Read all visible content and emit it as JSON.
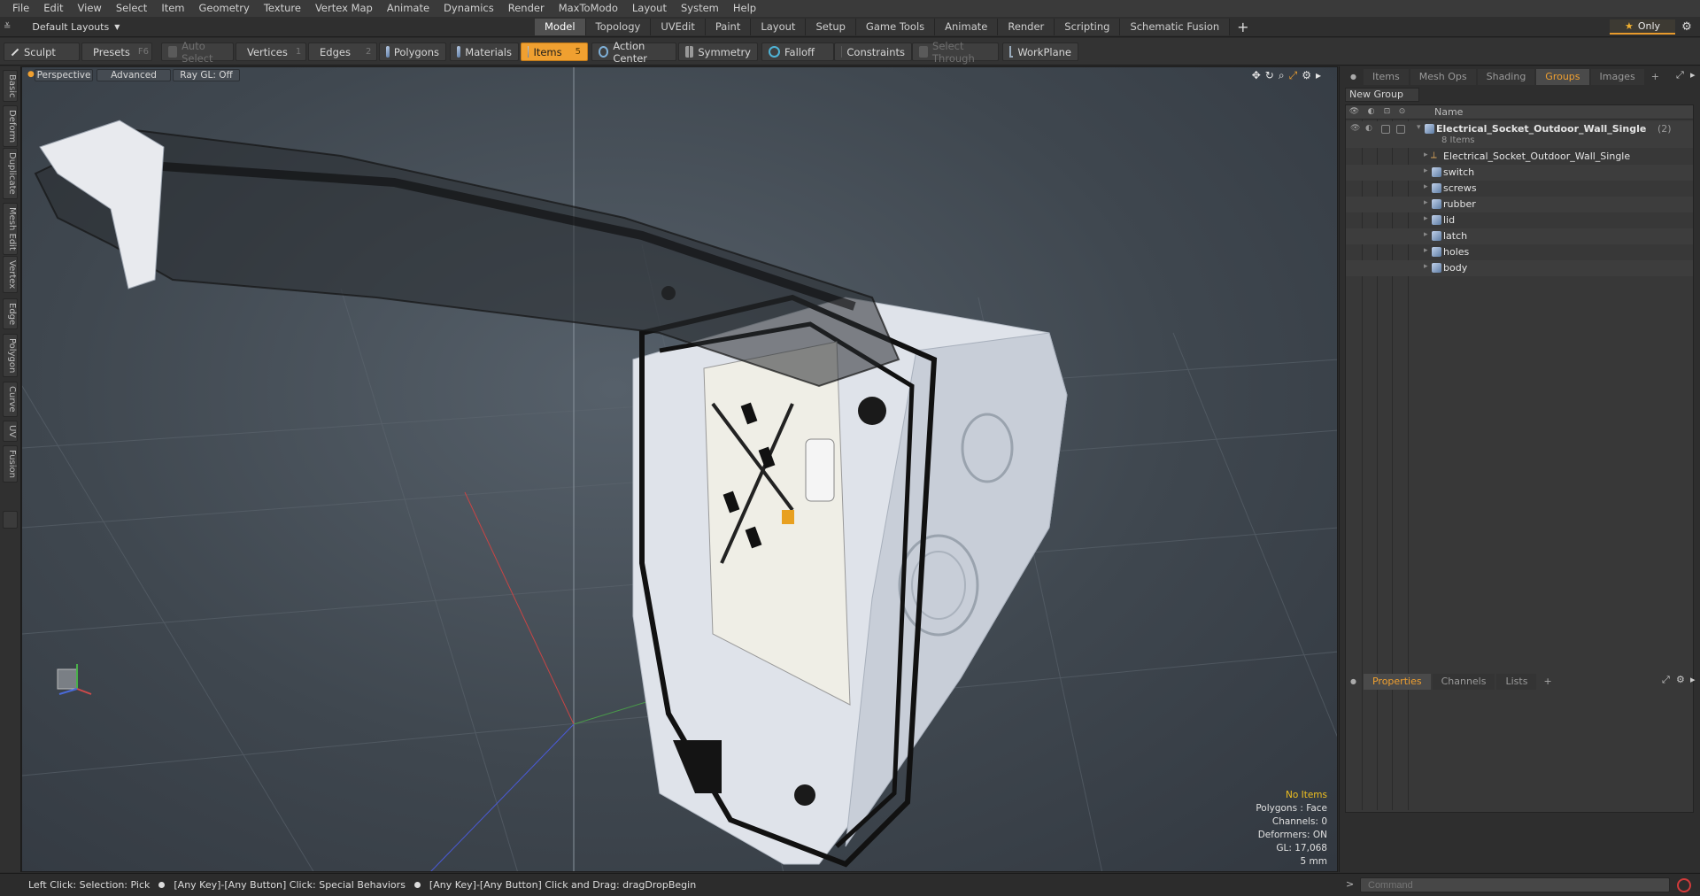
{
  "menu": [
    "File",
    "Edit",
    "View",
    "Select",
    "Item",
    "Geometry",
    "Texture",
    "Vertex Map",
    "Animate",
    "Dynamics",
    "Render",
    "MaxToModo",
    "Layout",
    "System",
    "Help"
  ],
  "layout": {
    "selector": "Default Layouts",
    "tabs": [
      "Model",
      "Topology",
      "UVEdit",
      "Paint",
      "Layout",
      "Setup",
      "Game Tools",
      "Animate",
      "Render",
      "Scripting",
      "Schematic Fusion"
    ],
    "active_tab": "Model",
    "only_label": "Only"
  },
  "toolbar": {
    "sculpt": "Sculpt",
    "presets": "Presets",
    "presets_key": "F6",
    "auto_select": "Auto Select",
    "vertices": "Vertices",
    "vertices_key": "1",
    "edges": "Edges",
    "edges_key": "2",
    "polygons": "Polygons",
    "materials": "Materials",
    "items": "Items",
    "items_key": "5",
    "action_center": "Action Center",
    "symmetry": "Symmetry",
    "falloff": "Falloff",
    "constraints": "Constraints",
    "select_through": "Select Through",
    "workplane": "WorkPlane"
  },
  "side_tools": [
    "Basic",
    "Deform",
    "Duplicate",
    "Mesh Edit",
    "Vertex",
    "Edge",
    "Polygon",
    "Curve",
    "UV",
    "Fusion"
  ],
  "viewport": {
    "view": "Perspective",
    "shading": "Advanced",
    "raygl": "Ray GL: Off",
    "info": {
      "selection": "No Items",
      "polygons": "Polygons : Face",
      "channels": "Channels: 0",
      "deformers": "Deformers: ON",
      "gl": "GL: 17,068",
      "grid": "5 mm"
    }
  },
  "panel": {
    "tabs": [
      "Items",
      "Mesh Ops",
      "Shading",
      "Groups",
      "Images"
    ],
    "active_tab": "Groups",
    "new_group": "New Group",
    "name_header": "Name",
    "root": {
      "name": "Electrical_Socket_Outdoor_Wall_Single",
      "count": "(2)",
      "sub": "8 Items"
    },
    "children": [
      "Electrical_Socket_Outdoor_Wall_Single",
      "switch",
      "screws",
      "rubber",
      "lid",
      "latch",
      "holes",
      "body"
    ],
    "bottom_tabs": [
      "Properties",
      "Channels",
      "Lists"
    ],
    "bottom_active": "Properties"
  },
  "status": {
    "s1": "Left Click: Selection: Pick",
    "s2": "[Any Key]-[Any Button] Click: Special Behaviors",
    "s3": "[Any Key]-[Any Button] Click and Drag: dragDropBegin"
  },
  "command": {
    "placeholder": "Command"
  }
}
